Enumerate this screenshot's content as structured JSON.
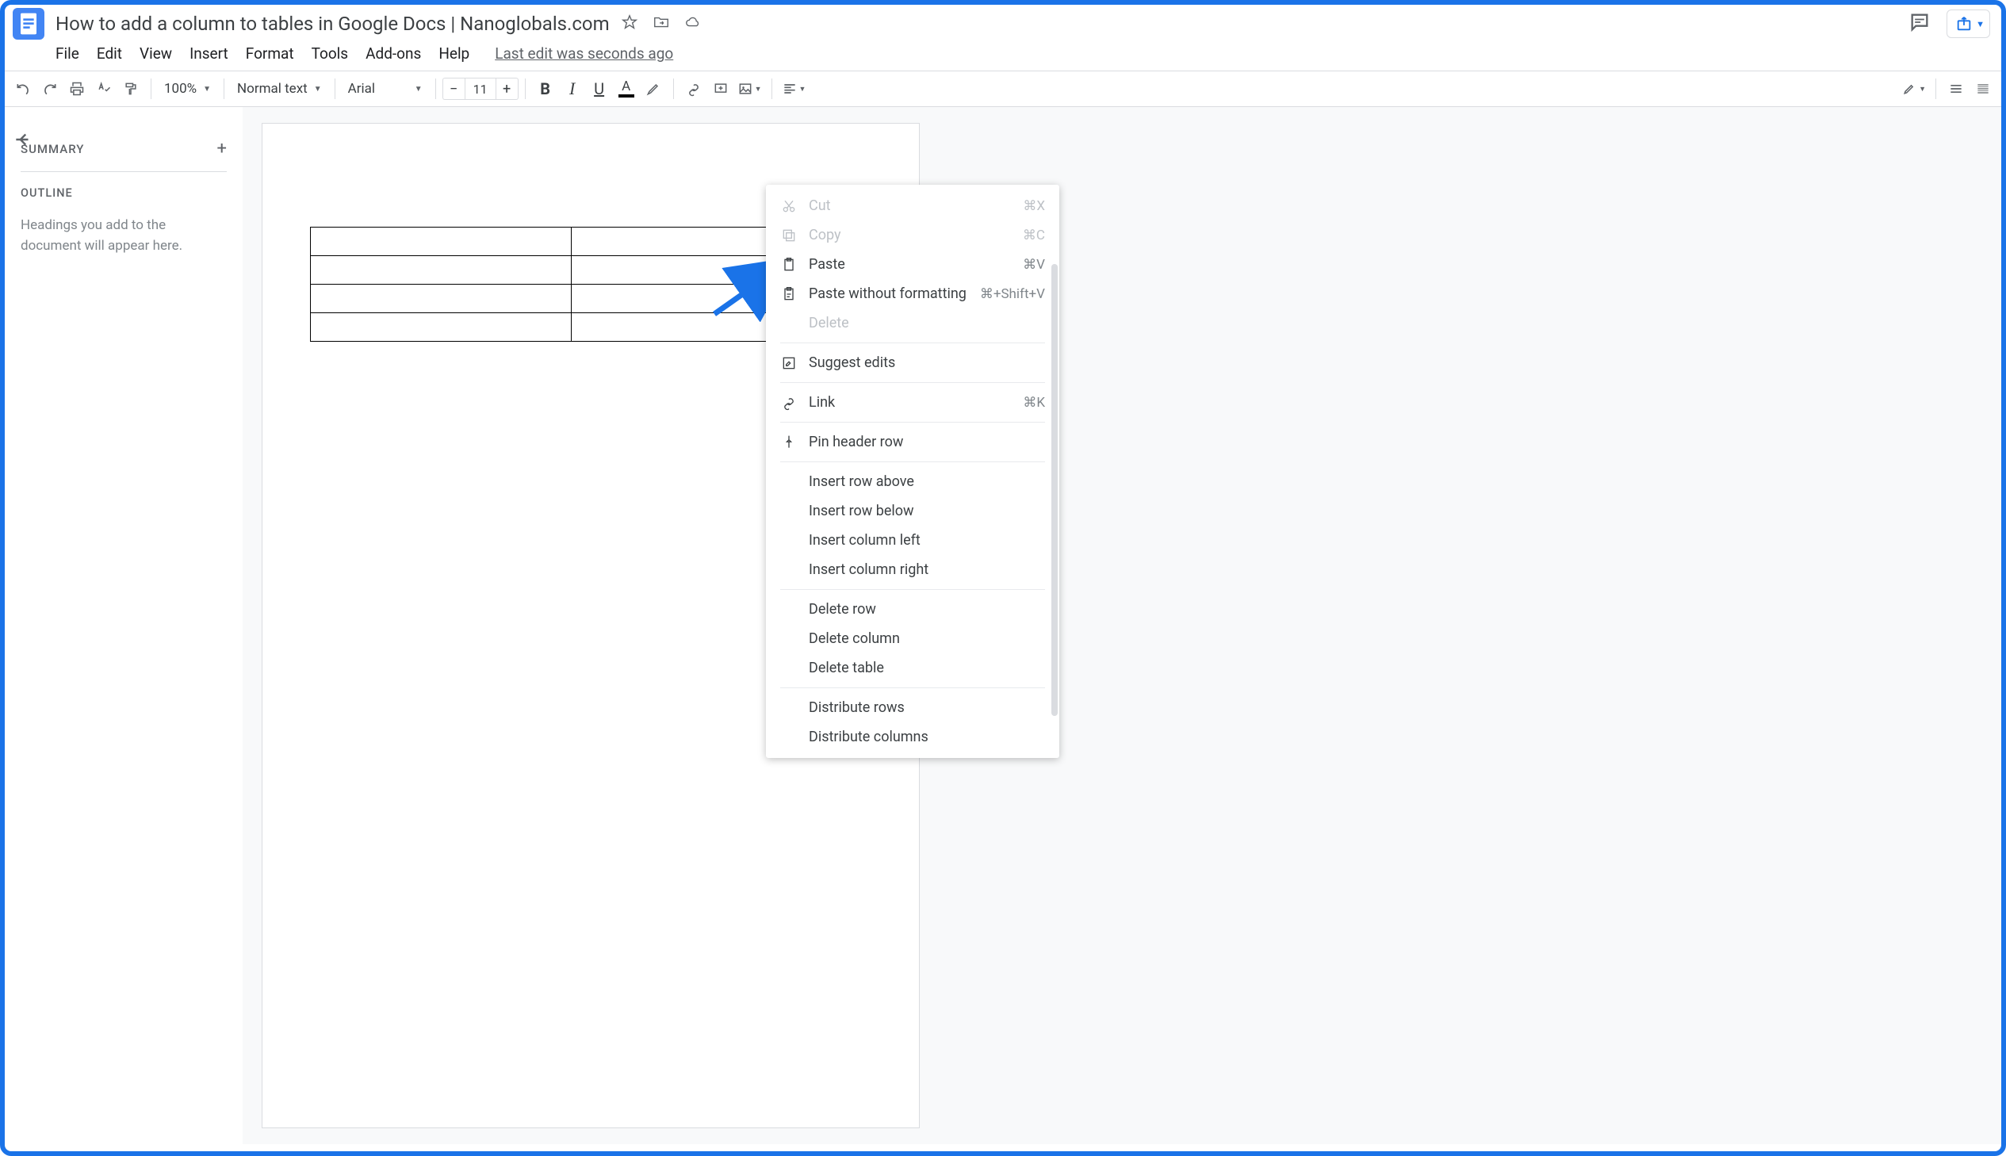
{
  "header": {
    "title": "How to add a column to tables in Google Docs | Nanoglobals.com",
    "last_edit": "Last edit was seconds ago"
  },
  "menubar": [
    "File",
    "Edit",
    "View",
    "Insert",
    "Format",
    "Tools",
    "Add-ons",
    "Help"
  ],
  "toolbar": {
    "zoom": "100%",
    "style": "Normal text",
    "font": "Arial",
    "font_size": "11"
  },
  "sidebar": {
    "summary_title": "SUMMARY",
    "outline_title": "OUTLINE",
    "outline_hint": "Headings you add to the document will appear here."
  },
  "context_menu": {
    "cut": {
      "label": "Cut",
      "shortcut": "⌘X",
      "disabled": true
    },
    "copy": {
      "label": "Copy",
      "shortcut": "⌘C",
      "disabled": true
    },
    "paste": {
      "label": "Paste",
      "shortcut": "⌘V"
    },
    "paste_plain": {
      "label": "Paste without formatting",
      "shortcut": "⌘+Shift+V"
    },
    "delete": {
      "label": "Delete",
      "disabled": true
    },
    "suggest": {
      "label": "Suggest edits"
    },
    "link": {
      "label": "Link",
      "shortcut": "⌘K"
    },
    "pin_header": {
      "label": "Pin header row"
    },
    "insert_row_above": {
      "label": "Insert row above"
    },
    "insert_row_below": {
      "label": "Insert row below"
    },
    "insert_col_left": {
      "label": "Insert column left"
    },
    "insert_col_right": {
      "label": "Insert column right"
    },
    "delete_row": {
      "label": "Delete row"
    },
    "delete_column": {
      "label": "Delete column"
    },
    "delete_table": {
      "label": "Delete table"
    },
    "distribute_rows": {
      "label": "Distribute rows"
    },
    "distribute_cols": {
      "label": "Distribute columns"
    }
  },
  "table": {
    "rows": 4,
    "cols": 3
  }
}
